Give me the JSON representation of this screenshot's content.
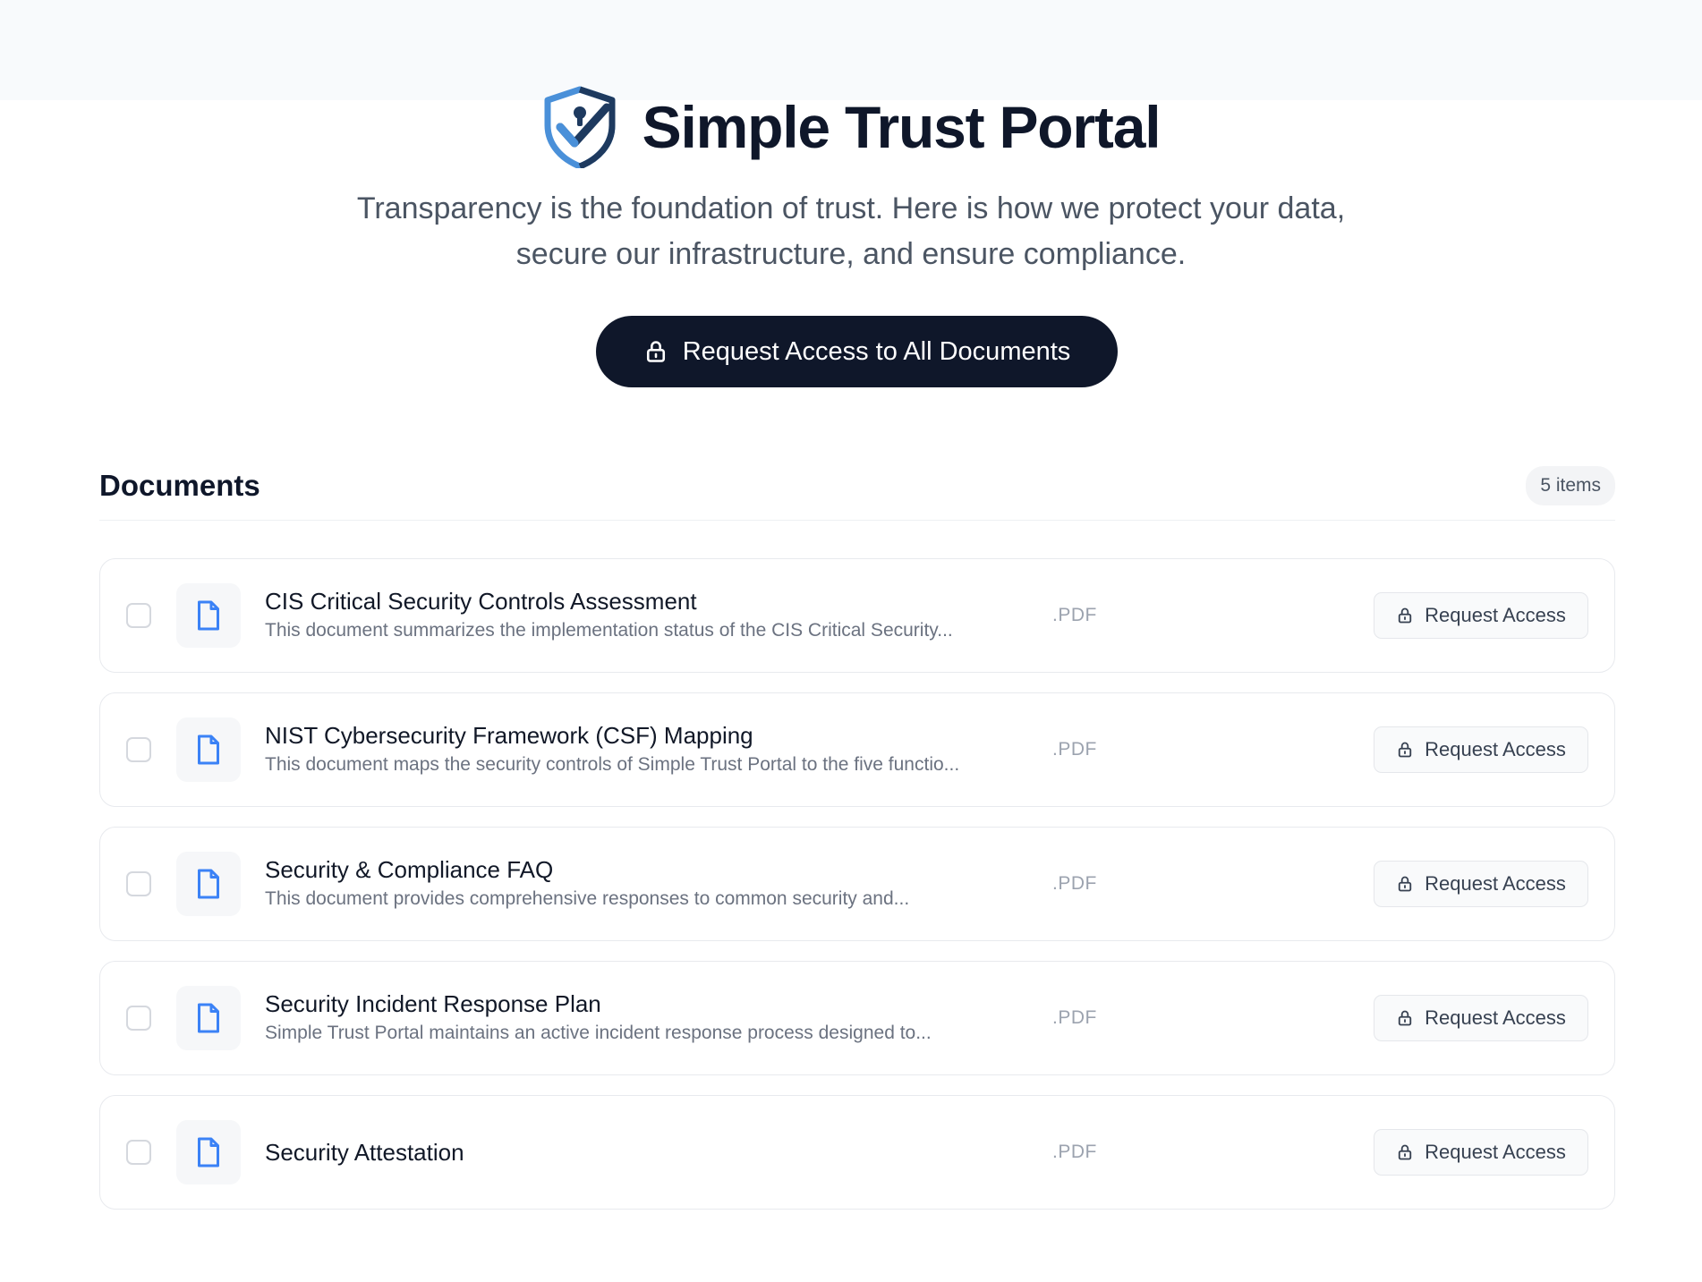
{
  "header": {
    "title": "Simple Trust Portal",
    "subtitle_line1": "Transparency is the foundation of trust. Here is how we protect your data,",
    "subtitle_line2": "secure our infrastructure, and ensure compliance.",
    "logo_icon": "shield-keyhole-check-icon"
  },
  "cta": {
    "label": "Request Access to All Documents",
    "icon": "lock-icon"
  },
  "documents": {
    "section_title": "Documents",
    "count_label": "5 items",
    "items": [
      {
        "title": "CIS Critical Security Controls Assessment",
        "description": "This document summarizes the implementation status of the CIS Critical Security...",
        "extension": ".PDF",
        "action_label": "Request Access"
      },
      {
        "title": "NIST Cybersecurity Framework (CSF) Mapping",
        "description": "This document maps the security controls of Simple Trust Portal to the five functio...",
        "extension": ".PDF",
        "action_label": "Request Access"
      },
      {
        "title": "Security & Compliance FAQ",
        "description": "This document provides comprehensive responses to common security and...",
        "extension": ".PDF",
        "action_label": "Request Access"
      },
      {
        "title": "Security Incident Response Plan",
        "description": "Simple Trust Portal maintains an active incident response process designed to...",
        "extension": ".PDF",
        "action_label": "Request Access"
      },
      {
        "title": "Security Attestation",
        "description": "",
        "extension": ".PDF",
        "action_label": "Request Access"
      }
    ]
  },
  "colors": {
    "primary_dark": "#0f172a",
    "file_icon_blue": "#3b82f6",
    "logo_blue": "#4a90d9",
    "logo_navy": "#1e3a5f"
  }
}
